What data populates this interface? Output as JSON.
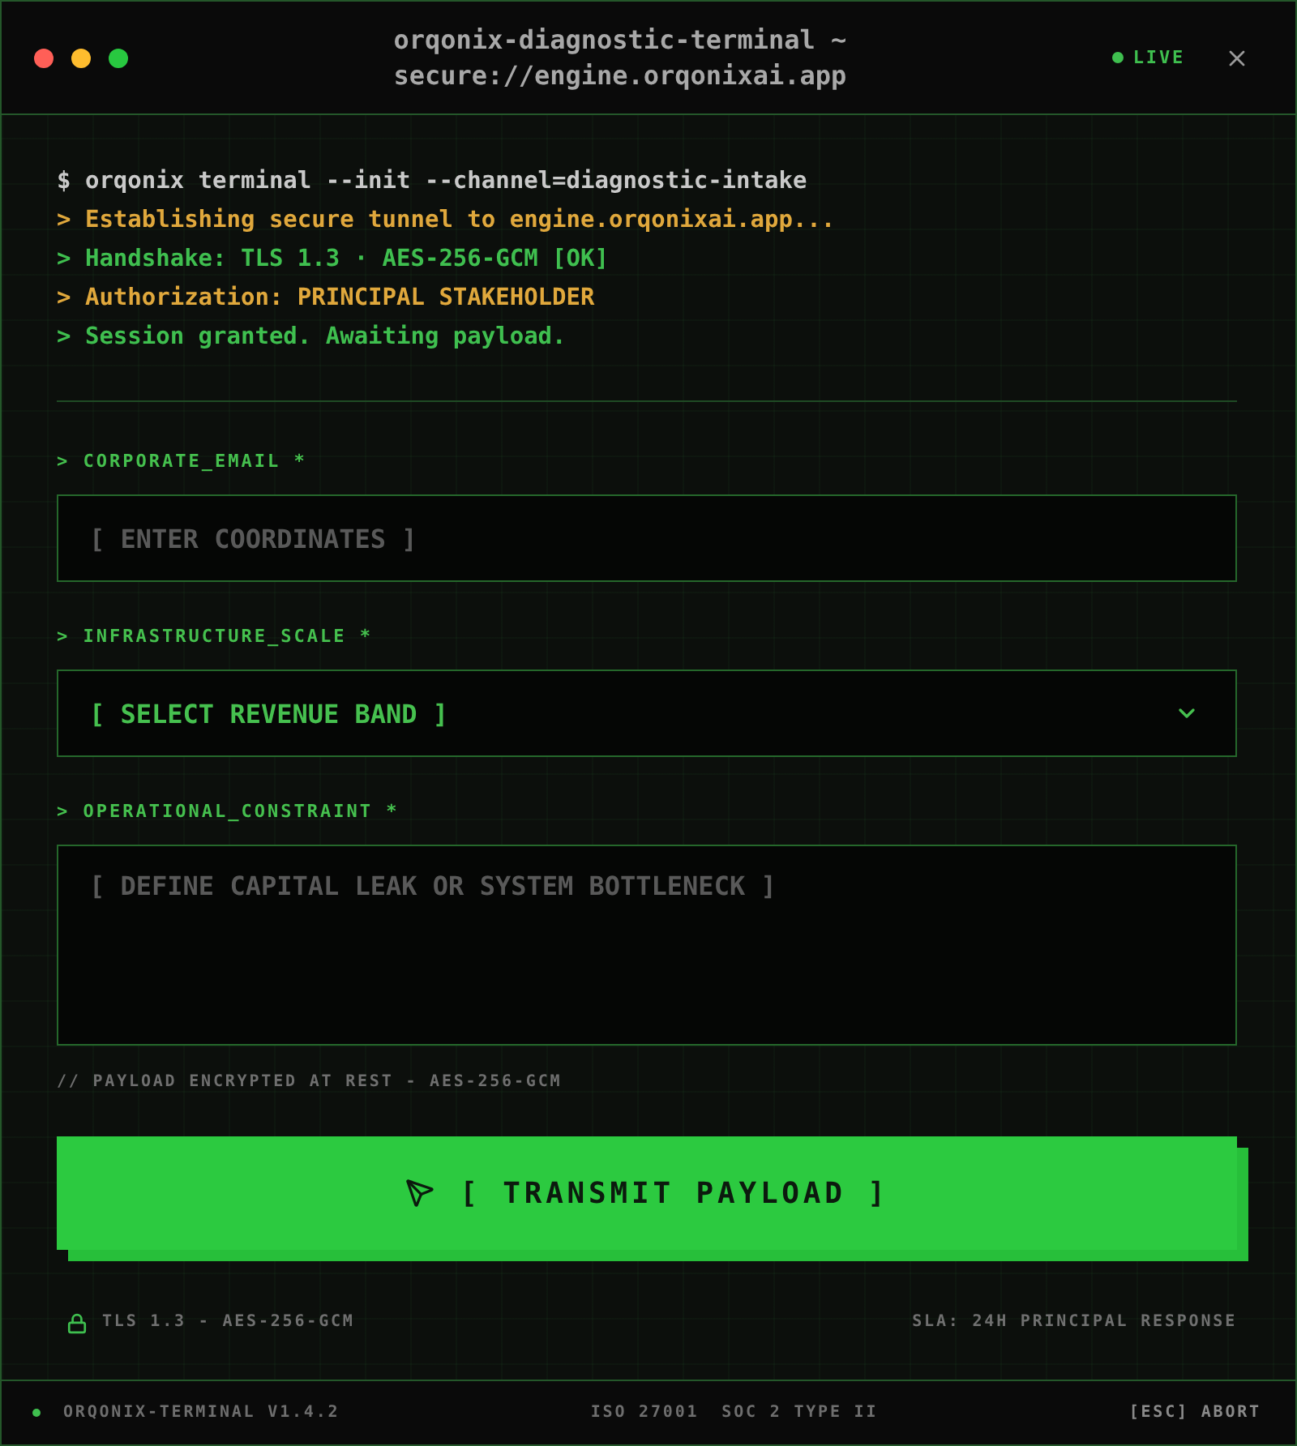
{
  "window": {
    "title": "orqonix-diagnostic-terminal ~ secure://engine.orqonixai.app",
    "status": "LIVE"
  },
  "console": [
    {
      "kind": "command",
      "text": "$ orqonix terminal --init --channel=diagnostic-intake"
    },
    {
      "kind": "warning",
      "text": "> Establishing secure tunnel to engine.orqonixai.app..."
    },
    {
      "kind": "success",
      "text": "> Handshake: TLS 1.3 · AES-256-GCM [OK]"
    },
    {
      "kind": "warning",
      "text": "> Authorization: PRINCIPAL STAKEHOLDER"
    },
    {
      "kind": "success",
      "text": "> Session granted. Awaiting payload."
    }
  ],
  "form": {
    "fields": [
      {
        "kind": "text",
        "label": "> CORPORATE_EMAIL *",
        "placeholder": "[ ENTER COORDINATES ]"
      },
      {
        "kind": "select",
        "label": "> INFRASTRUCTURE_SCALE *",
        "value": "[ SELECT REVENUE BAND ]"
      },
      {
        "kind": "textarea",
        "label": "> OPERATIONAL_CONSTRAINT *",
        "placeholder": "[ DEFINE CAPITAL LEAK OR SYSTEM BOTTLENECK ]"
      }
    ],
    "note": "// PAYLOAD ENCRYPTED AT REST - AES-256-GCM",
    "submit": "[ TRANSMIT PAYLOAD ]",
    "security": "TLS 1.3 - AES-256-GCM",
    "sla": "SLA: 24H PRINCIPAL RESPONSE"
  },
  "status_bar": {
    "version": "ORQONIX-TERMINAL V1.4.2",
    "certifications": [
      "ISO 27001",
      "SOC 2 TYPE II"
    ],
    "abort": "[ESC] ABORT"
  }
}
